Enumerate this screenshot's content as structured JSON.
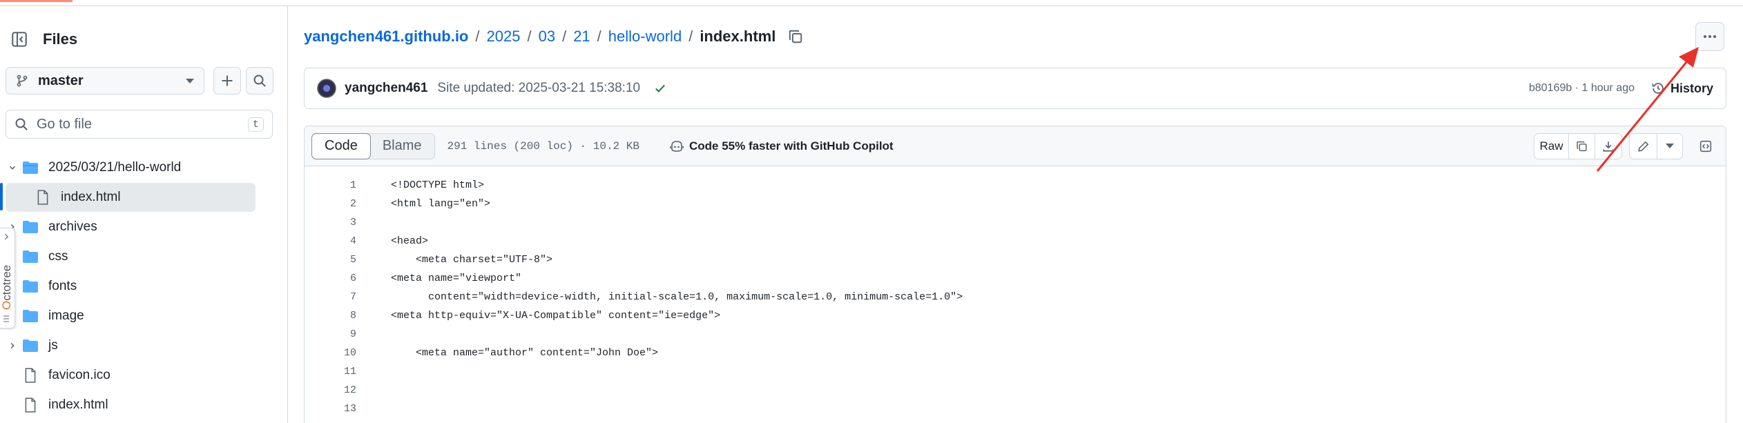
{
  "sidebar": {
    "title": "Files",
    "branch": "master",
    "goto_placeholder": "Go to file",
    "goto_shortcut": "t",
    "tree": [
      {
        "label": "2025/03/21/hello-world",
        "type": "folder",
        "expanded": true
      },
      {
        "label": "index.html",
        "type": "file",
        "selected": true
      },
      {
        "label": "archives",
        "type": "folder"
      },
      {
        "label": "css",
        "type": "folder"
      },
      {
        "label": "fonts",
        "type": "folder"
      },
      {
        "label": "image",
        "type": "folder"
      },
      {
        "label": "js",
        "type": "folder"
      },
      {
        "label": "favicon.ico",
        "type": "file"
      },
      {
        "label": "index.html",
        "type": "file"
      }
    ]
  },
  "octotree": {
    "label": "Octotree"
  },
  "breadcrumb": {
    "repo": "yangchen461.github.io",
    "parts": [
      "2025",
      "03",
      "21",
      "hello-world"
    ],
    "current": "index.html",
    "sep": "/"
  },
  "commit": {
    "author": "yangchen461",
    "message": "Site updated: 2025-03-21 15:38:10",
    "sha_time": "b80169b · 1 hour ago",
    "history_label": "History"
  },
  "file": {
    "tabs": [
      "Code",
      "Blame"
    ],
    "info": "291 lines (200 loc) · 10.2 KB",
    "copilot": "Code 55% faster with GitHub Copilot",
    "raw_label": "Raw"
  },
  "code_lines": [
    {
      "n": "1",
      "text": "<!DOCTYPE html>"
    },
    {
      "n": "2",
      "text": "<html lang=\"en\">"
    },
    {
      "n": "3",
      "text": ""
    },
    {
      "n": "4",
      "text": "<head>"
    },
    {
      "n": "5",
      "text": "    <meta charset=\"UTF-8\">"
    },
    {
      "n": "6",
      "text": "<meta name=\"viewport\""
    },
    {
      "n": "7",
      "text": "      content=\"width=device-width, initial-scale=1.0, maximum-scale=1.0, minimum-scale=1.0\">"
    },
    {
      "n": "8",
      "text": "<meta http-equiv=\"X-UA-Compatible\" content=\"ie=edge\">"
    },
    {
      "n": "9",
      "text": ""
    },
    {
      "n": "10",
      "text": "    <meta name=\"author\" content=\"John Doe\">"
    },
    {
      "n": "11",
      "text": ""
    },
    {
      "n": "12",
      "text": ""
    },
    {
      "n": "13",
      "text": ""
    }
  ],
  "colors": {
    "accent": "#0969da",
    "arrow": "#e8312a",
    "success": "#1a7f37"
  }
}
